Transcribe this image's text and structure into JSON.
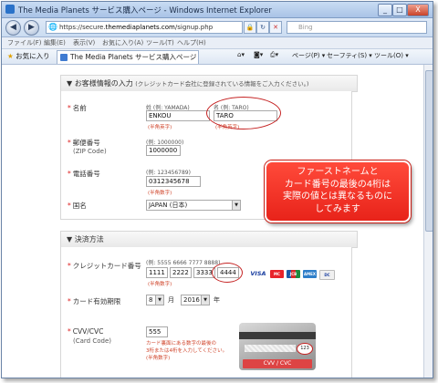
{
  "window": {
    "title": "The Media Planets サービス購入ページ - Windows Internet Explorer",
    "min_label": "_",
    "max_label": "□",
    "close_label": "X"
  },
  "address": {
    "back_glyph": "◀",
    "forward_glyph": "▶",
    "url_prefix": "https://secure.",
    "url_domain": "themediaplanets.com",
    "url_path": "/signup.php",
    "search_placeholder": "Bing"
  },
  "menu": [
    "ファイル(F)",
    "編集(E)",
    "表示(V)",
    "お気に入り(A)",
    "ツール(T)",
    "ヘルプ(H)"
  ],
  "favorites": {
    "label": "お気に入り",
    "tab_title": "The Media Planets サービス購入ページ",
    "tools": [
      "ページ(P) ▾",
      "セーフティ(S) ▾",
      "ツール(O) ▾"
    ]
  },
  "customer": {
    "section_title": "▼ お客様情報の入力",
    "section_note": "(クレジットカード会社に登録されている情報をご入力ください。)",
    "name_label": "名前",
    "last_example": "姓 (例: YAMADA)",
    "first_example": "名 (例: TARO)",
    "last_name": "ENKOU",
    "first_name": "TARO",
    "halfwidth_hint": "(半角英字)",
    "zip_label": "郵便番号",
    "zip_sub": "(ZIP Code)",
    "zip_example": "(例: 1000000)",
    "zip_value": "1000000",
    "phone_label": "電話番号",
    "phone_example": "(例: 123456789)",
    "phone_value": "0312345678",
    "phone_hint": "(半角数字)",
    "country_label": "国名",
    "country_value": "JAPAN (日本)"
  },
  "callout": {
    "lines": [
      "ファーストネームと",
      "カード番号の最後の4桁は",
      "実際の値とは異なるものに",
      "してみます"
    ]
  },
  "payment": {
    "section_title": "▼ 決済方法",
    "card_label": "クレジットカード番号",
    "card_example": "(例: 5555 6666 7777 8888)",
    "card_parts": [
      "1111",
      "2222",
      "3333",
      "4444"
    ],
    "card_hint": "(半角数字)",
    "expiry_label": "カード有効期限",
    "month": "8",
    "month_unit": "月",
    "year": "2016",
    "year_unit": "年",
    "brands": [
      "VISA",
      "MC",
      "JCB",
      "AMEX",
      "DC"
    ],
    "cvv_label": "CVV/CVC",
    "cvv_sub": "(Card Code)",
    "cvv_value": "555",
    "cvv_hint_1": "カード裏面にある数字の最後の",
    "cvv_hint_2": "3桁または4桁を入力してください。",
    "cvv_hint_3": "(半角数字)",
    "cvv_card_caption": "CVV / CVC",
    "cvv_card_code": "123"
  },
  "colors": {
    "accent_red": "#e8231a",
    "ie_blue": "#2a72c9"
  }
}
